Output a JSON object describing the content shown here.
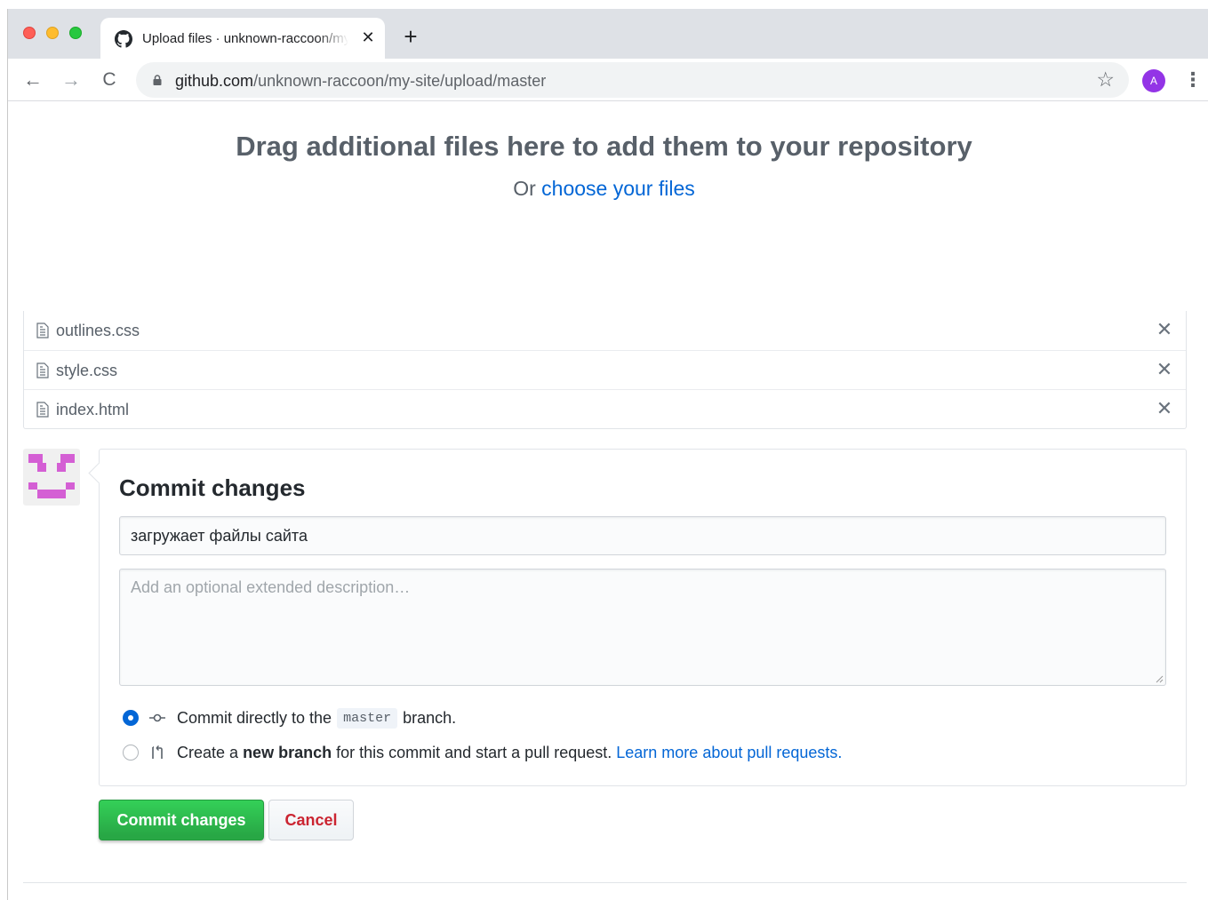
{
  "browser": {
    "tab": {
      "title": "Upload files · unknown-raccoon/my-site",
      "favicon": "github-octocat-icon"
    },
    "address": {
      "host": "github.com",
      "path": "/unknown-raccoon/my-site/upload/master"
    },
    "profile_initial": "A",
    "icons": {
      "back": "←",
      "forward": "→",
      "reload": "C",
      "star": "☆",
      "menu": "⋮",
      "new_tab": "+",
      "close_tab": "✕"
    }
  },
  "upload": {
    "drop_title": "Drag additional files here to add them to your repository",
    "drop_or": "Or",
    "choose_link": "choose your files"
  },
  "files": [
    {
      "name": "outlines.css"
    },
    {
      "name": "style.css"
    },
    {
      "name": "index.html"
    }
  ],
  "commit": {
    "heading": "Commit changes",
    "summary_value": "загружает файлы сайта",
    "description_placeholder": "Add an optional extended description…",
    "option_direct": {
      "prefix": "Commit directly to the",
      "branch": "master",
      "suffix": "branch.",
      "checked": true
    },
    "option_new_branch": {
      "prefix": "Create a",
      "bold": "new branch",
      "suffix": "for this commit and start a pull request.",
      "link": "Learn more about pull requests.",
      "checked": false
    },
    "submit_label": "Commit changes",
    "cancel_label": "Cancel"
  },
  "colors": {
    "link": "#0366d6",
    "primary_green": "#28a745",
    "danger_red": "#cb2431",
    "avatar_magenta": "#d45fd4",
    "profile_purple": "#9334e6"
  }
}
